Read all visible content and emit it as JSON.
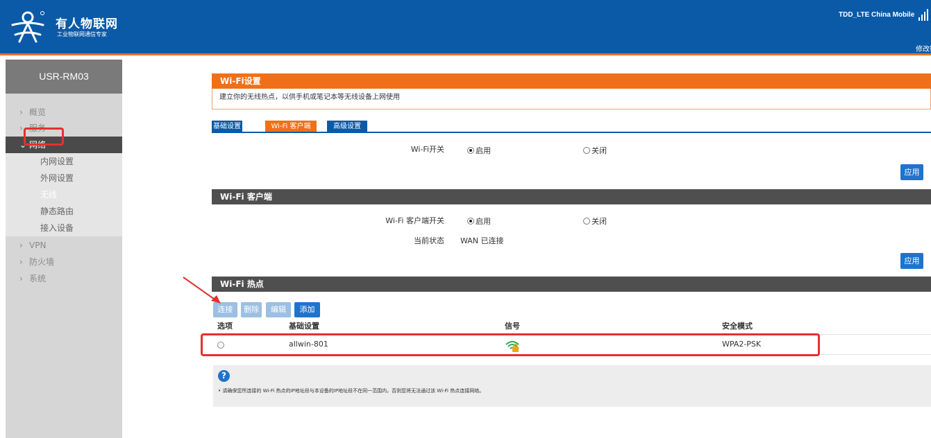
{
  "header": {
    "brand_name": "有人物联网",
    "brand_slogan": "工业物联网通信专家",
    "network_status": "TDD_LTE  China Mobile",
    "modify_link": "修改密码"
  },
  "sidebar": {
    "device_name": "USR-RM03",
    "items": [
      {
        "label": "概览"
      },
      {
        "label": "服务"
      },
      {
        "label": "网络"
      },
      {
        "label": "VPN"
      },
      {
        "label": "防火墙"
      },
      {
        "label": "系统"
      }
    ],
    "network_subitems": [
      {
        "label": "内网设置"
      },
      {
        "label": "外网设置"
      },
      {
        "label": "无线"
      },
      {
        "label": "静态路由"
      },
      {
        "label": "接入设备"
      }
    ]
  },
  "wifi_settings": {
    "title": "Wi-Fi设置",
    "description": "建立你的无线热点，以供手机或笔记本等无线设备上网使用",
    "tabs": [
      {
        "label": "基础设置"
      },
      {
        "label": "Wi-Fi 客户端"
      },
      {
        "label": "高级设置"
      }
    ],
    "switch_label": "Wi-Fi开关",
    "option_on": "启用",
    "option_off": "关闭",
    "apply_label": "应用"
  },
  "wifi_client": {
    "title": "Wi-Fi 客户端",
    "switch_label": "Wi-Fi 客户端开关",
    "option_on": "启用",
    "option_off": "关闭",
    "state_label": "当前状态",
    "state_value": "WAN 已连接",
    "apply_label": "应用"
  },
  "hotspot": {
    "title": "Wi-Fi 热点",
    "buttons": [
      {
        "label": "连接",
        "enabled": false
      },
      {
        "label": "删除",
        "enabled": false
      },
      {
        "label": "编辑",
        "enabled": false
      },
      {
        "label": "添加",
        "enabled": true
      }
    ],
    "columns": [
      "选项",
      "基础设置",
      "信号",
      "安全模式"
    ],
    "rows": [
      {
        "ssid": "allwin-801",
        "signal_icon": "wifi-signal-lock-icon",
        "security": "WPA2-PSK"
      }
    ]
  },
  "note": {
    "text": "• 请确保您所连接的 Wi-Fi 热点的IP地址段与本设备的IP地址段不在同一范围内，否则您将无法通过该 Wi-Fi 热点连接网络。"
  },
  "colors": {
    "brand_blue": "#0b5aa8",
    "accent_orange": "#f07019",
    "highlight_red": "#e53030"
  }
}
